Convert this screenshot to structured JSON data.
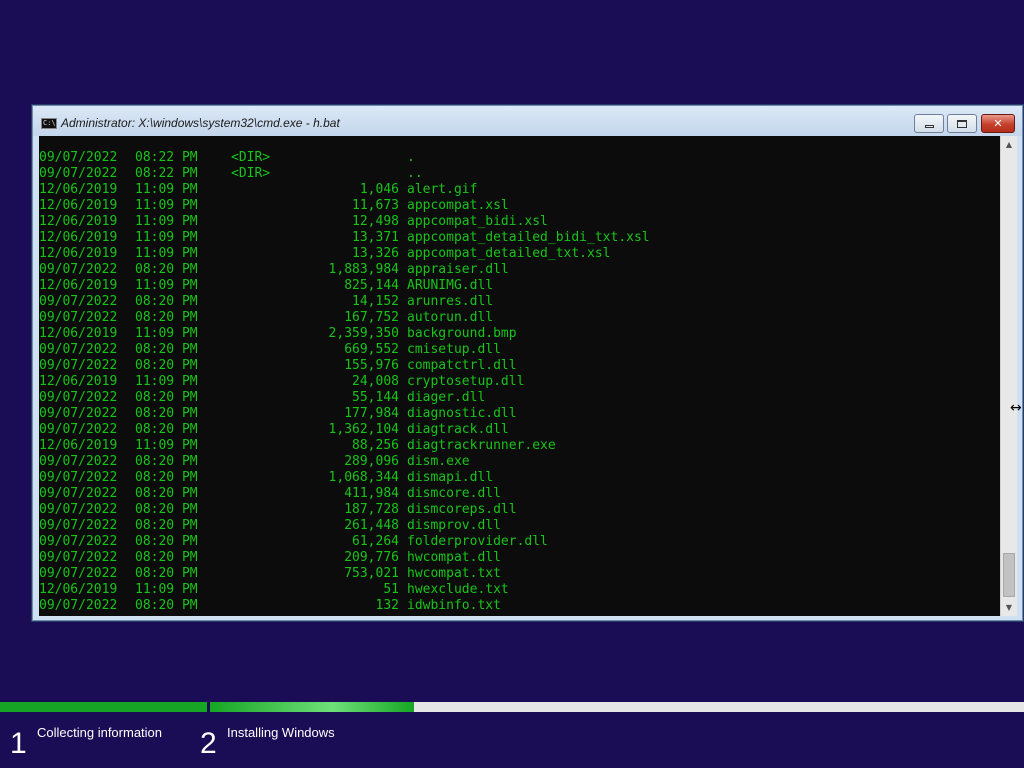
{
  "window": {
    "title": "Administrator: X:\\windows\\system32\\cmd.exe - h.bat",
    "icon_text": "C:\\_"
  },
  "console": {
    "text_color": "#18c418",
    "background": "#0c0c0c",
    "rows": [
      {
        "date": "09/07/2022",
        "time": "08:22 PM",
        "dir": "<DIR>",
        "size": "",
        "name": "."
      },
      {
        "date": "09/07/2022",
        "time": "08:22 PM",
        "dir": "<DIR>",
        "size": "",
        "name": ".."
      },
      {
        "date": "12/06/2019",
        "time": "11:09 PM",
        "dir": "",
        "size": "1,046",
        "name": "alert.gif"
      },
      {
        "date": "12/06/2019",
        "time": "11:09 PM",
        "dir": "",
        "size": "11,673",
        "name": "appcompat.xsl"
      },
      {
        "date": "12/06/2019",
        "time": "11:09 PM",
        "dir": "",
        "size": "12,498",
        "name": "appcompat_bidi.xsl"
      },
      {
        "date": "12/06/2019",
        "time": "11:09 PM",
        "dir": "",
        "size": "13,371",
        "name": "appcompat_detailed_bidi_txt.xsl"
      },
      {
        "date": "12/06/2019",
        "time": "11:09 PM",
        "dir": "",
        "size": "13,326",
        "name": "appcompat_detailed_txt.xsl"
      },
      {
        "date": "09/07/2022",
        "time": "08:20 PM",
        "dir": "",
        "size": "1,883,984",
        "name": "appraiser.dll"
      },
      {
        "date": "12/06/2019",
        "time": "11:09 PM",
        "dir": "",
        "size": "825,144",
        "name": "ARUNIMG.dll"
      },
      {
        "date": "09/07/2022",
        "time": "08:20 PM",
        "dir": "",
        "size": "14,152",
        "name": "arunres.dll"
      },
      {
        "date": "09/07/2022",
        "time": "08:20 PM",
        "dir": "",
        "size": "167,752",
        "name": "autorun.dll"
      },
      {
        "date": "12/06/2019",
        "time": "11:09 PM",
        "dir": "",
        "size": "2,359,350",
        "name": "background.bmp"
      },
      {
        "date": "09/07/2022",
        "time": "08:20 PM",
        "dir": "",
        "size": "669,552",
        "name": "cmisetup.dll"
      },
      {
        "date": "09/07/2022",
        "time": "08:20 PM",
        "dir": "",
        "size": "155,976",
        "name": "compatctrl.dll"
      },
      {
        "date": "12/06/2019",
        "time": "11:09 PM",
        "dir": "",
        "size": "24,008",
        "name": "cryptosetup.dll"
      },
      {
        "date": "09/07/2022",
        "time": "08:20 PM",
        "dir": "",
        "size": "55,144",
        "name": "diager.dll"
      },
      {
        "date": "09/07/2022",
        "time": "08:20 PM",
        "dir": "",
        "size": "177,984",
        "name": "diagnostic.dll"
      },
      {
        "date": "09/07/2022",
        "time": "08:20 PM",
        "dir": "",
        "size": "1,362,104",
        "name": "diagtrack.dll"
      },
      {
        "date": "12/06/2019",
        "time": "11:09 PM",
        "dir": "",
        "size": "88,256",
        "name": "diagtrackrunner.exe"
      },
      {
        "date": "09/07/2022",
        "time": "08:20 PM",
        "dir": "",
        "size": "289,096",
        "name": "dism.exe"
      },
      {
        "date": "09/07/2022",
        "time": "08:20 PM",
        "dir": "",
        "size": "1,068,344",
        "name": "dismapi.dll"
      },
      {
        "date": "09/07/2022",
        "time": "08:20 PM",
        "dir": "",
        "size": "411,984",
        "name": "dismcore.dll"
      },
      {
        "date": "09/07/2022",
        "time": "08:20 PM",
        "dir": "",
        "size": "187,728",
        "name": "dismcoreps.dll"
      },
      {
        "date": "09/07/2022",
        "time": "08:20 PM",
        "dir": "",
        "size": "261,448",
        "name": "dismprov.dll"
      },
      {
        "date": "09/07/2022",
        "time": "08:20 PM",
        "dir": "",
        "size": "61,264",
        "name": "folderprovider.dll"
      },
      {
        "date": "09/07/2022",
        "time": "08:20 PM",
        "dir": "",
        "size": "209,776",
        "name": "hwcompat.dll"
      },
      {
        "date": "09/07/2022",
        "time": "08:20 PM",
        "dir": "",
        "size": "753,021",
        "name": "hwcompat.txt"
      },
      {
        "date": "12/06/2019",
        "time": "11:09 PM",
        "dir": "",
        "size": "51",
        "name": "hwexclude.txt"
      },
      {
        "date": "09/07/2022",
        "time": "08:20 PM",
        "dir": "",
        "size": "132",
        "name": "idwbinfo.txt"
      }
    ]
  },
  "setup": {
    "accent": "#16a524",
    "background": "#1b0d55",
    "step1_progress": 1.0,
    "step2_progress": 0.25,
    "steps": [
      {
        "number": "1",
        "label": "Collecting information"
      },
      {
        "number": "2",
        "label": "Installing Windows"
      }
    ]
  }
}
